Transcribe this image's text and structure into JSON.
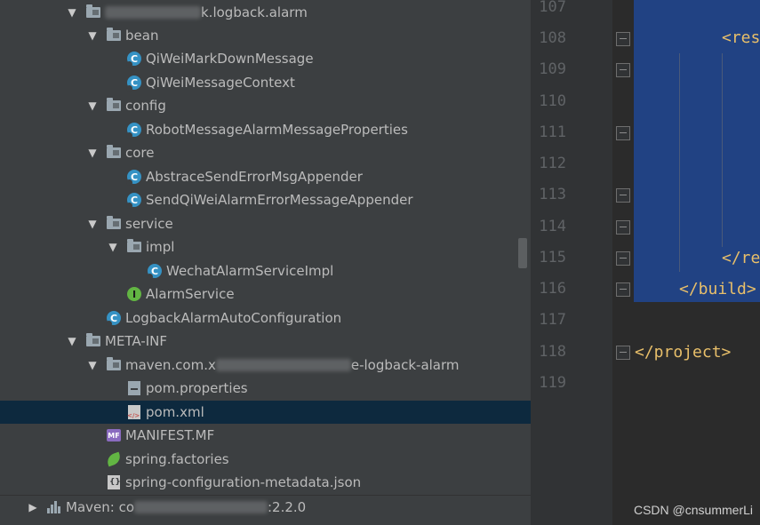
{
  "tree": {
    "rows": [
      {
        "label": "k.logback.alarm",
        "icon": "package-folder-icon",
        "arrow": "expanded",
        "redacted_prefix": true
      },
      {
        "label": "bean",
        "icon": "package-folder-icon",
        "arrow": "expanded"
      },
      {
        "label": "QiWeiMarkDownMessage",
        "icon": "class-icon"
      },
      {
        "label": "QiWeiMessageContext",
        "icon": "class-icon"
      },
      {
        "label": "config",
        "icon": "package-folder-icon",
        "arrow": "expanded"
      },
      {
        "label": "RobotMessageAlarmMessageProperties",
        "icon": "class-icon"
      },
      {
        "label": "core",
        "icon": "package-folder-icon",
        "arrow": "expanded"
      },
      {
        "label": "AbstraceSendErrorMsgAppender",
        "icon": "abstract-class-icon"
      },
      {
        "label": "SendQiWeiAlarmErrorMessageAppender",
        "icon": "class-icon"
      },
      {
        "label": "service",
        "icon": "package-folder-icon",
        "arrow": "expanded"
      },
      {
        "label": "impl",
        "icon": "package-folder-icon",
        "arrow": "expanded"
      },
      {
        "label": "WechatAlarmServiceImpl",
        "icon": "class-icon"
      },
      {
        "label": "AlarmService",
        "icon": "interface-icon"
      },
      {
        "label": "LogbackAlarmAutoConfiguration",
        "icon": "class-icon"
      },
      {
        "label": "META-INF",
        "icon": "folder-icon",
        "arrow": "expanded"
      },
      {
        "label_start": "maven.com.x",
        "label_end": "e-logback-alarm",
        "icon": "folder-icon",
        "arrow": "expanded"
      },
      {
        "label": "pom.properties",
        "icon": "properties-file-icon"
      },
      {
        "label": "pom.xml",
        "icon": "xml-file-icon",
        "selected": true
      },
      {
        "label": "MANIFEST.MF",
        "icon": "manifest-file-icon"
      },
      {
        "label": "spring.factories",
        "icon": "spring-file-icon"
      },
      {
        "label": "spring-configuration-metadata.json",
        "icon": "json-file-icon"
      }
    ],
    "bottom": {
      "label_start": "Maven: co",
      "label_end": ":2.2.0",
      "icon": "maven-library-icon",
      "arrow": "collapsed"
    }
  },
  "editor": {
    "line_numbers": [
      "107",
      "108",
      "109",
      "110",
      "111",
      "112",
      "113",
      "114",
      "115",
      "116",
      "117",
      "118",
      "119"
    ],
    "code": {
      "line108": "<res",
      "line115": "</re",
      "line116": "</build>",
      "line118": "</project>"
    }
  },
  "watermark": "CSDN @cnsummerLi"
}
